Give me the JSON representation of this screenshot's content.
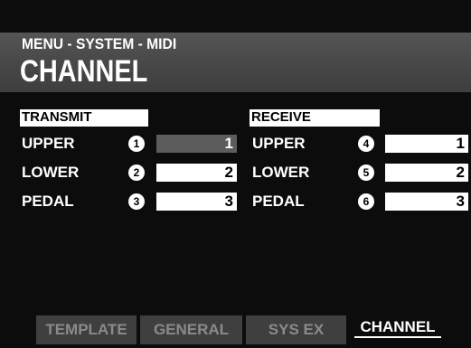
{
  "menu_path": "MENU - SYSTEM - MIDI",
  "page_title": "CHANNEL",
  "transmit": {
    "header": "TRANSMIT",
    "rows": [
      {
        "label": "UPPER",
        "number": "1",
        "value": "1",
        "selected": true
      },
      {
        "label": "LOWER",
        "number": "2",
        "value": "2",
        "selected": false
      },
      {
        "label": "PEDAL",
        "number": "3",
        "value": "3",
        "selected": false
      }
    ]
  },
  "receive": {
    "header": "RECEIVE",
    "rows": [
      {
        "label": "UPPER",
        "number": "4",
        "value": "1"
      },
      {
        "label": "LOWER",
        "number": "5",
        "value": "2"
      },
      {
        "label": "PEDAL",
        "number": "6",
        "value": "3"
      }
    ]
  },
  "tabs": [
    {
      "label": "TEMPLATE",
      "active": false
    },
    {
      "label": "GENERAL",
      "active": false
    },
    {
      "label": "SYS EX",
      "active": false
    },
    {
      "label": "CHANNEL",
      "active": true
    }
  ],
  "colors": {
    "background": "#0c0c0c",
    "header_band": "#474747",
    "selected_field": "#5c5c5c",
    "inactive_tab": "#3f3f3f",
    "inactive_tab_text": "#8a8a8a"
  }
}
